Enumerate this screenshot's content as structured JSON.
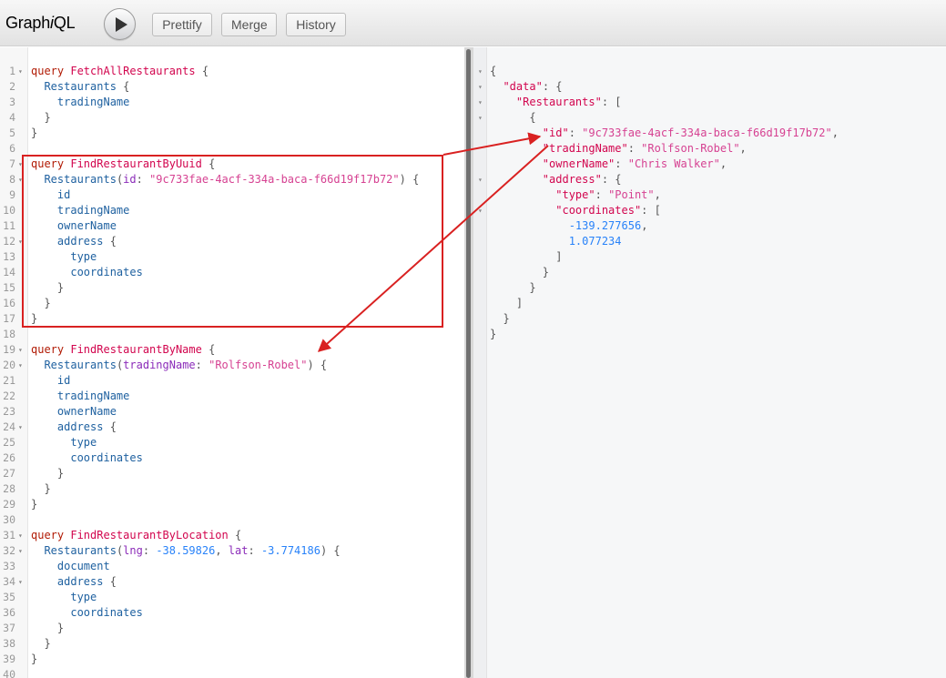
{
  "toolbar": {
    "logo_prefix": "Graph",
    "logo_i": "i",
    "logo_suffix": "QL",
    "prettify_label": "Prettify",
    "merge_label": "Merge",
    "history_label": "History"
  },
  "query_lines": [
    {
      "n": "1",
      "fold": true,
      "tokens": [
        [
          "k",
          "query"
        ],
        [
          "pun",
          " "
        ],
        [
          "def",
          "FetchAllRestaurants"
        ],
        [
          "pun",
          " {"
        ]
      ]
    },
    {
      "n": "2",
      "tokens": [
        [
          "pun",
          "  "
        ],
        [
          "prop",
          "Restaurants"
        ],
        [
          "pun",
          " {"
        ]
      ]
    },
    {
      "n": "3",
      "tokens": [
        [
          "pun",
          "    "
        ],
        [
          "prop",
          "tradingName"
        ]
      ]
    },
    {
      "n": "4",
      "tokens": [
        [
          "pun",
          "  }"
        ]
      ]
    },
    {
      "n": "5",
      "tokens": [
        [
          "pun",
          "}"
        ]
      ]
    },
    {
      "n": "6",
      "tokens": []
    },
    {
      "n": "7",
      "fold": true,
      "tokens": [
        [
          "k",
          "query"
        ],
        [
          "pun",
          " "
        ],
        [
          "def",
          "FindRestaurantByUuid"
        ],
        [
          "pun",
          " {"
        ]
      ]
    },
    {
      "n": "8",
      "fold": true,
      "tokens": [
        [
          "pun",
          "  "
        ],
        [
          "prop",
          "Restaurants"
        ],
        [
          "pun",
          "("
        ],
        [
          "attr",
          "id"
        ],
        [
          "pun",
          ": "
        ],
        [
          "str",
          "\"9c733fae-4acf-334a-baca-f66d19f17b72\""
        ],
        [
          "pun",
          ") {"
        ]
      ]
    },
    {
      "n": "9",
      "tokens": [
        [
          "pun",
          "    "
        ],
        [
          "prop",
          "id"
        ]
      ]
    },
    {
      "n": "10",
      "tokens": [
        [
          "pun",
          "    "
        ],
        [
          "prop",
          "tradingName"
        ]
      ]
    },
    {
      "n": "11",
      "tokens": [
        [
          "pun",
          "    "
        ],
        [
          "prop",
          "ownerName"
        ]
      ]
    },
    {
      "n": "12",
      "fold": true,
      "tokens": [
        [
          "pun",
          "    "
        ],
        [
          "prop",
          "address"
        ],
        [
          "pun",
          " {"
        ]
      ]
    },
    {
      "n": "13",
      "tokens": [
        [
          "pun",
          "      "
        ],
        [
          "prop",
          "type"
        ]
      ]
    },
    {
      "n": "14",
      "tokens": [
        [
          "pun",
          "      "
        ],
        [
          "prop",
          "coordinates"
        ]
      ]
    },
    {
      "n": "15",
      "tokens": [
        [
          "pun",
          "    }"
        ]
      ]
    },
    {
      "n": "16",
      "tokens": [
        [
          "pun",
          "  }"
        ]
      ]
    },
    {
      "n": "17",
      "tokens": [
        [
          "pun",
          "}"
        ]
      ]
    },
    {
      "n": "18",
      "tokens": []
    },
    {
      "n": "19",
      "fold": true,
      "tokens": [
        [
          "k",
          "query"
        ],
        [
          "pun",
          " "
        ],
        [
          "def",
          "FindRestaurantByName"
        ],
        [
          "pun",
          " {"
        ]
      ]
    },
    {
      "n": "20",
      "fold": true,
      "tokens": [
        [
          "pun",
          "  "
        ],
        [
          "prop",
          "Restaurants"
        ],
        [
          "pun",
          "("
        ],
        [
          "attr",
          "tradingName"
        ],
        [
          "pun",
          ": "
        ],
        [
          "str",
          "\"Rolfson-Robel\""
        ],
        [
          "pun",
          ") {"
        ]
      ]
    },
    {
      "n": "21",
      "tokens": [
        [
          "pun",
          "    "
        ],
        [
          "prop",
          "id"
        ]
      ]
    },
    {
      "n": "22",
      "tokens": [
        [
          "pun",
          "    "
        ],
        [
          "prop",
          "tradingName"
        ]
      ]
    },
    {
      "n": "23",
      "tokens": [
        [
          "pun",
          "    "
        ],
        [
          "prop",
          "ownerName"
        ]
      ]
    },
    {
      "n": "24",
      "fold": true,
      "tokens": [
        [
          "pun",
          "    "
        ],
        [
          "prop",
          "address"
        ],
        [
          "pun",
          " {"
        ]
      ]
    },
    {
      "n": "25",
      "tokens": [
        [
          "pun",
          "      "
        ],
        [
          "prop",
          "type"
        ]
      ]
    },
    {
      "n": "26",
      "tokens": [
        [
          "pun",
          "      "
        ],
        [
          "prop",
          "coordinates"
        ]
      ]
    },
    {
      "n": "27",
      "tokens": [
        [
          "pun",
          "    }"
        ]
      ]
    },
    {
      "n": "28",
      "tokens": [
        [
          "pun",
          "  }"
        ]
      ]
    },
    {
      "n": "29",
      "tokens": [
        [
          "pun",
          "}"
        ]
      ]
    },
    {
      "n": "30",
      "tokens": []
    },
    {
      "n": "31",
      "fold": true,
      "tokens": [
        [
          "k",
          "query"
        ],
        [
          "pun",
          " "
        ],
        [
          "def",
          "FindRestaurantByLocation"
        ],
        [
          "pun",
          " {"
        ]
      ]
    },
    {
      "n": "32",
      "fold": true,
      "tokens": [
        [
          "pun",
          "  "
        ],
        [
          "prop",
          "Restaurants"
        ],
        [
          "pun",
          "("
        ],
        [
          "attr",
          "lng"
        ],
        [
          "pun",
          ": "
        ],
        [
          "num",
          "-38.59826"
        ],
        [
          "pun",
          ", "
        ],
        [
          "attr",
          "lat"
        ],
        [
          "pun",
          ": "
        ],
        [
          "num",
          "-3.774186"
        ],
        [
          "pun",
          ") {"
        ]
      ]
    },
    {
      "n": "33",
      "tokens": [
        [
          "pun",
          "    "
        ],
        [
          "prop",
          "document"
        ]
      ]
    },
    {
      "n": "34",
      "fold": true,
      "tokens": [
        [
          "pun",
          "    "
        ],
        [
          "prop",
          "address"
        ],
        [
          "pun",
          " {"
        ]
      ]
    },
    {
      "n": "35",
      "tokens": [
        [
          "pun",
          "      "
        ],
        [
          "prop",
          "type"
        ]
      ]
    },
    {
      "n": "36",
      "tokens": [
        [
          "pun",
          "      "
        ],
        [
          "prop",
          "coordinates"
        ]
      ]
    },
    {
      "n": "37",
      "tokens": [
        [
          "pun",
          "    }"
        ]
      ]
    },
    {
      "n": "38",
      "tokens": [
        [
          "pun",
          "  }"
        ]
      ]
    },
    {
      "n": "39",
      "tokens": [
        [
          "pun",
          "}"
        ]
      ]
    },
    {
      "n": "40",
      "tokens": []
    }
  ],
  "result_lines": [
    {
      "fold": true,
      "tokens": [
        [
          "pun",
          "{"
        ]
      ]
    },
    {
      "fold": true,
      "tokens": [
        [
          "pun",
          "  "
        ],
        [
          "def",
          "\"data\""
        ],
        [
          "pun",
          ": {"
        ]
      ]
    },
    {
      "fold": true,
      "tokens": [
        [
          "pun",
          "    "
        ],
        [
          "def",
          "\"Restaurants\""
        ],
        [
          "pun",
          ": ["
        ]
      ]
    },
    {
      "fold": true,
      "tokens": [
        [
          "pun",
          "      {"
        ]
      ]
    },
    {
      "tokens": [
        [
          "pun",
          "        "
        ],
        [
          "def",
          "\"id\""
        ],
        [
          "pun",
          ": "
        ],
        [
          "str",
          "\"9c733fae-4acf-334a-baca-f66d19f17b72\""
        ],
        [
          "pun",
          ","
        ]
      ]
    },
    {
      "tokens": [
        [
          "pun",
          "        "
        ],
        [
          "def",
          "\"tradingName\""
        ],
        [
          "pun",
          ": "
        ],
        [
          "str",
          "\"Rolfson-Robel\""
        ],
        [
          "pun",
          ","
        ]
      ]
    },
    {
      "tokens": [
        [
          "pun",
          "        "
        ],
        [
          "def",
          "\"ownerName\""
        ],
        [
          "pun",
          ": "
        ],
        [
          "str",
          "\"Chris Walker\""
        ],
        [
          "pun",
          ","
        ]
      ]
    },
    {
      "fold": true,
      "tokens": [
        [
          "pun",
          "        "
        ],
        [
          "def",
          "\"address\""
        ],
        [
          "pun",
          ": {"
        ]
      ]
    },
    {
      "tokens": [
        [
          "pun",
          "          "
        ],
        [
          "def",
          "\"type\""
        ],
        [
          "pun",
          ": "
        ],
        [
          "str",
          "\"Point\""
        ],
        [
          "pun",
          ","
        ]
      ]
    },
    {
      "fold": true,
      "tokens": [
        [
          "pun",
          "          "
        ],
        [
          "def",
          "\"coordinates\""
        ],
        [
          "pun",
          ": ["
        ]
      ]
    },
    {
      "tokens": [
        [
          "pun",
          "            "
        ],
        [
          "num",
          "-139.277656"
        ],
        [
          "pun",
          ","
        ]
      ]
    },
    {
      "tokens": [
        [
          "pun",
          "            "
        ],
        [
          "num",
          "1.077234"
        ]
      ]
    },
    {
      "tokens": [
        [
          "pun",
          "          ]"
        ]
      ]
    },
    {
      "tokens": [
        [
          "pun",
          "        }"
        ]
      ]
    },
    {
      "tokens": [
        [
          "pun",
          "      }"
        ]
      ]
    },
    {
      "tokens": [
        [
          "pun",
          "    ]"
        ]
      ]
    },
    {
      "tokens": [
        [
          "pun",
          "  }"
        ]
      ]
    },
    {
      "tokens": [
        [
          "pun",
          "}"
        ]
      ]
    }
  ],
  "annotation_color": "#d92121"
}
